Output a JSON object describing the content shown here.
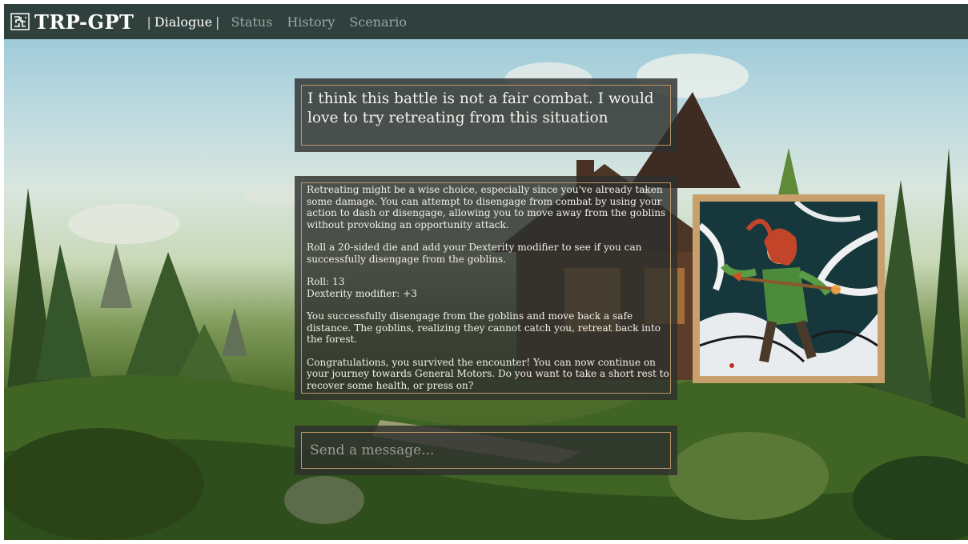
{
  "app": {
    "title": "TRP-GPT",
    "logo_icon": "maze-grid-icon"
  },
  "nav": {
    "separator": "|",
    "items": [
      {
        "label": "Dialogue",
        "active": true
      },
      {
        "label": "Status",
        "active": false
      },
      {
        "label": "History",
        "active": false
      },
      {
        "label": "Scenario",
        "active": false
      }
    ]
  },
  "dialogue": {
    "user_message": "I think this battle is not a fair combat. I would love to try retreating from this situation",
    "reply": {
      "p1": "Retreating might be a wise choice, especially since you've already taken some damage. You can attempt to disengage from combat by using your action to dash or disengage, allowing you to move away from the goblins without provoking an opportunity attack.",
      "p2": "Roll a 20-sided die and add your Dexterity modifier to see if you can successfully disengage from the goblins.",
      "roll": "Roll: 13",
      "dex": "Dexterity modifier: +3",
      "p3": "You successfully disengage from the goblins and move back a safe distance. The goblins, realizing they cannot catch you, retreat back into the forest.",
      "p4": "Congratulations, you survived the encounter! You can now continue on your journey towards General Motors. Do you want to take a short rest to recover some health, or press on?"
    }
  },
  "input": {
    "placeholder": "Send a message..."
  },
  "portrait": {
    "icon": "character-portrait-image"
  },
  "colors": {
    "nav_bg": "#263430",
    "accent_border": "#b8946a",
    "portrait_frame": "#c9a06c",
    "panel_bg": "#2d2f2d"
  }
}
